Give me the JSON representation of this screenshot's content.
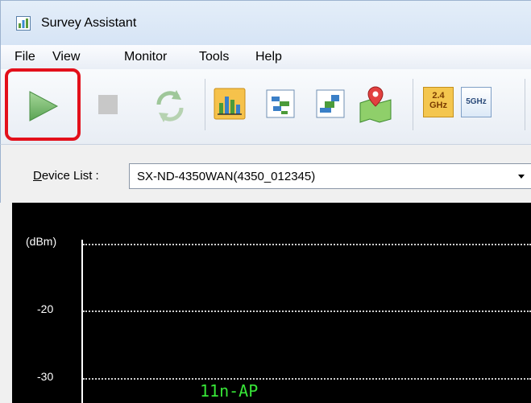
{
  "window": {
    "title": "Survey Assistant"
  },
  "menu": {
    "items": [
      {
        "label": "File"
      },
      {
        "label": "View"
      },
      {
        "label": "Monitor"
      },
      {
        "label": "Tools"
      },
      {
        "label": "Help"
      }
    ]
  },
  "toolbar": {
    "start_icon": "play-icon",
    "stop_icon": "stop-icon",
    "refresh_icon": "refresh-icon",
    "band_24_label_top": "2.4",
    "band_24_label_bottom": "GHz",
    "band_5_label": "5GHz",
    "highlight_color": "#e3101b"
  },
  "device_list": {
    "label_prefix": "D",
    "label_rest": "evice List :",
    "selected": "SX-ND-4350WAN(4350_012345)"
  },
  "chart_data": {
    "type": "line",
    "ylabel": "(dBm)",
    "ticks": [
      "-20",
      "-30"
    ],
    "series": [
      {
        "name": "11n-AP",
        "values": []
      }
    ],
    "grid": true
  },
  "colors": {
    "chart_bg": "#000000",
    "series_label": "#37e537"
  }
}
